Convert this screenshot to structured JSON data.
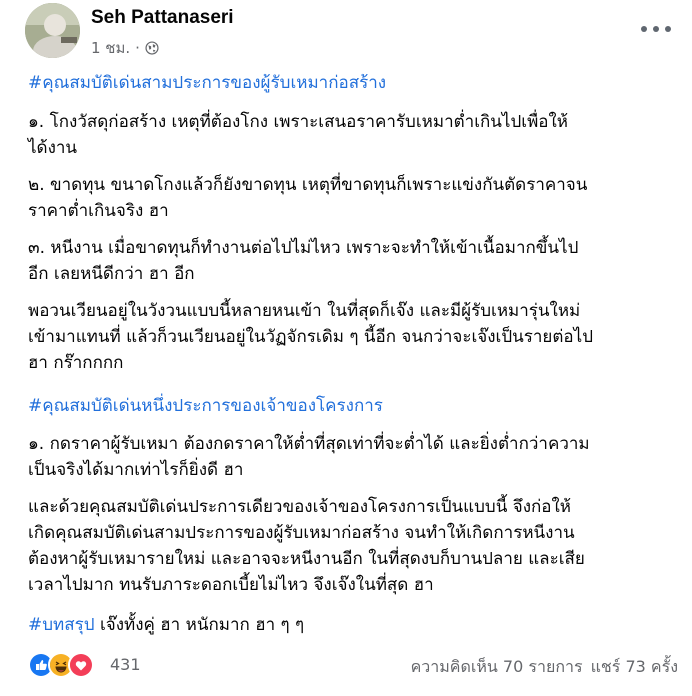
{
  "author": "Seh Pattanaseri",
  "timestamp": "1 ชม.",
  "separator": "·",
  "privacy_icon": "globe-icon",
  "more_icon": "more-options-icon",
  "paragraphs": [
    {
      "type": "hashtag",
      "text": "#คุณสมบัติเด่นสามประการของผู้รับเหมาก่อสร้าง"
    },
    {
      "type": "text",
      "text": "๑. โกงวัสดุก่อสร้าง เหตุที่ต้องโกง เพราะเสนอราคารับเหมาต่ำเกินไปเพื่อให้\nได้งาน"
    },
    {
      "type": "text",
      "text": "๒. ขาดทุน ขนาดโกงแล้วก็ยังขาดทุน เหตุที่ขาดทุนก็เพราะแข่งกันตัดราคาจน\nราคาต่ำเกินจริง ฮา"
    },
    {
      "type": "text",
      "text": "๓. หนีงาน เมื่อขาดทุนก็ทำงานต่อไปไม่ไหว เพราะจะทำให้เข้าเนื้อมากขึ้นไป\nอีก เลยหนีดีกว่า ฮา อีก"
    },
    {
      "type": "text",
      "text": "พอวนเวียนอยู่ในวังวนแบบนี้หลายหนเข้า ในที่สุดก็เจ๊ง และมีผู้รับเหมารุ่นใหม่\nเข้ามาแทนที่ แล้วก็วนเวียนอยู่ในวัฏจักรเดิม ๆ นี้อีก จนกว่าจะเจ๊งเป็นรายต่อไป\nฮา กร๊ากกกก"
    },
    {
      "type": "hashtag",
      "text": "#คุณสมบัติเด่นหนึ่งประการของเจ้าของโครงการ"
    },
    {
      "type": "text",
      "text": "๑. กดราคาผู้รับเหมา ต้องกดราคาให้ต่ำที่สุดเท่าที่จะต่ำได้ และยิ่งต่ำกว่าความ\nเป็นจริงได้มากเท่าไรก็ยิ่งดี ฮา"
    },
    {
      "type": "text",
      "text": "และด้วยคุณสมบัติเด่นประการเดียวของเจ้าของโครงการเป็นแบบนี้ จึงก่อให้\nเกิดคุณสมบัติเด่นสามประการของผู้รับเหมาก่อสร้าง จนทำให้เกิดการหนีงาน\nต้องหาผู้รับเหมารายใหม่ และอาจจะหนีงานอีก ในที่สุดงบก็บานปลาย และเสีย\nเวลาไปมาก ทนรับภาระดอกเบี้ยไม่ไหว จึงเจ๊งในที่สุด ฮา"
    },
    {
      "type": "mixed",
      "hashtag": "#บทสรุป",
      "text": " เจ๊งทั้งคู่ ฮา หนักมาก ฮา ๆ ๆ"
    }
  ],
  "reactions": {
    "icons": [
      "like-icon",
      "haha-icon",
      "love-icon"
    ],
    "count": "431",
    "colors": {
      "like": "#1877f2",
      "haha": "#f7b125",
      "love": "#f33e58"
    }
  },
  "stats": {
    "comments": "ความคิดเห็น 70 รายการ",
    "shares": "แชร์ 73 ครั้ง"
  },
  "colors": {
    "hashtag": "#216fdb",
    "secondary_text": "#65676b"
  }
}
